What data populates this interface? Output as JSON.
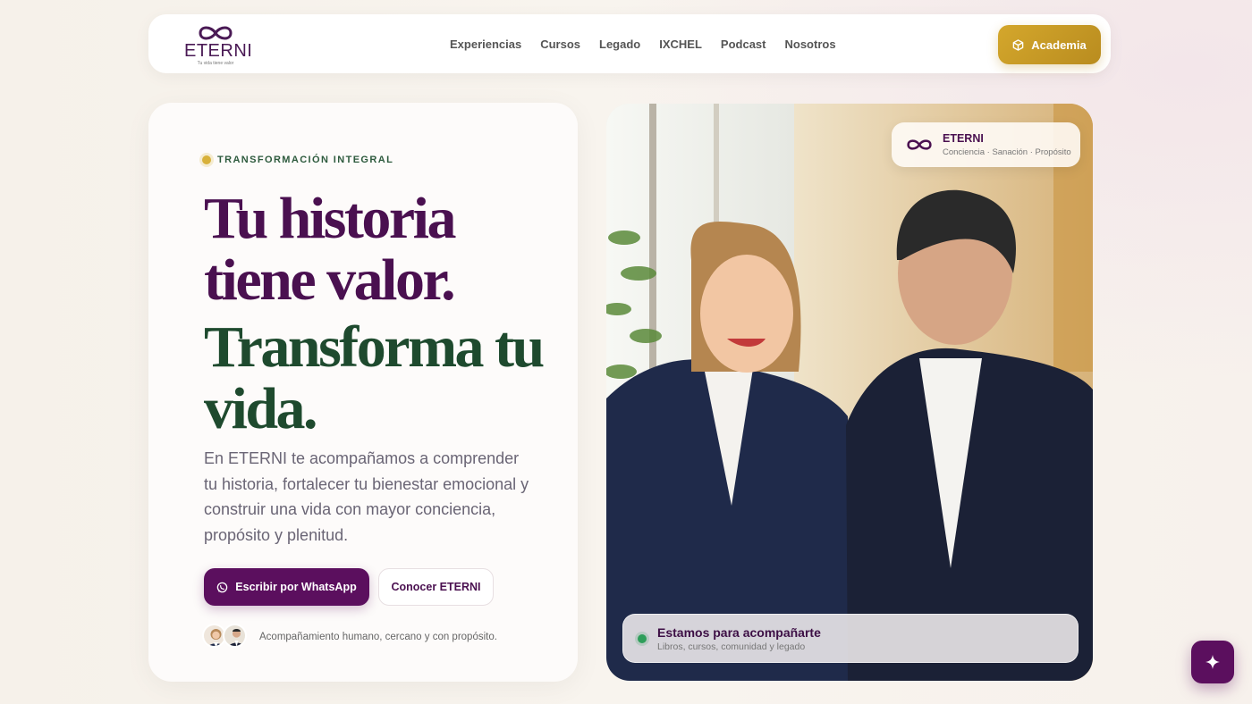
{
  "nav": {
    "logo_text": "ETERNI",
    "logo_tagline": "Tu vida tiene valor",
    "items": [
      {
        "label": "Experiencias"
      },
      {
        "label": "Cursos"
      },
      {
        "label": "Legado"
      },
      {
        "label": "IXCHEL"
      },
      {
        "label": "Podcast"
      },
      {
        "label": "Nosotros"
      }
    ],
    "cta_label": "Academia",
    "cta_icon": "cube-icon"
  },
  "hero": {
    "eyebrow": "TRANSFORMACIÓN INTEGRAL",
    "headline_line1": "Tu historia",
    "headline_line2": "tiene valor.",
    "headline_line3": "Transforma tu",
    "headline_line4": "vida.",
    "lead": "En ETERNI te acompañamos a comprender tu historia, fortalecer tu bienestar emocional y construir una vida con mayor conciencia, propósito y plenitud.",
    "primary_button": "Escribir por WhatsApp",
    "secondary_button": "Conocer ETERNI",
    "tagline": "Acompañamiento humano, cercano y con propósito."
  },
  "photo": {
    "brand_title": "ETERNI",
    "brand_subtitle": "Conciencia · Sanación · Propósito",
    "status_title": "Estamos para acompañarte",
    "status_subtitle": "Libros, cursos, comunidad y legado"
  },
  "colors": {
    "brand_purple": "#5b0f5e",
    "headline_purple": "#4a1050",
    "headline_green": "#1e4a2e",
    "gold": "#c9991f",
    "status_green": "#2e9e5a"
  }
}
